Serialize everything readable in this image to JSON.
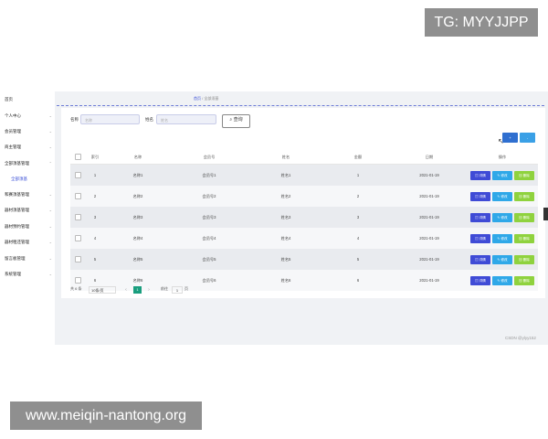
{
  "overlay": {
    "tg": "TG: MYYJJPP",
    "site": "www.meiqin-nantong.org"
  },
  "sidebar": {
    "items": [
      {
        "label": "首页"
      },
      {
        "label": "个人中心"
      },
      {
        "label": "会员管理"
      },
      {
        "label": "商主管理"
      },
      {
        "label": "全部须基管理"
      },
      {
        "label": "全部须基"
      },
      {
        "label": "和赛须基管理"
      },
      {
        "label": "器材须基管理"
      },
      {
        "label": "器材预约管理"
      },
      {
        "label": "器材租还管理"
      },
      {
        "label": "留言板管理"
      },
      {
        "label": "系统管理"
      }
    ]
  },
  "breadcrumb": {
    "home": "首页",
    "sep": "/",
    "current": "全部须基"
  },
  "search": {
    "name_label": "名称",
    "name_placeholder": "名称",
    "person_label": "姓名",
    "person_placeholder": "姓名",
    "button_label": "查询"
  },
  "toolbar": {
    "add_label": "+",
    "delete_label": "-"
  },
  "table": {
    "headers": [
      "",
      "索引",
      "名称",
      "会员号",
      "姓名",
      "金额",
      "日期",
      "操作"
    ],
    "rows": [
      {
        "index": "1",
        "name": "名称1",
        "member": "会员号1",
        "person": "姓名1",
        "amount": "1",
        "date": "2021-01-19"
      },
      {
        "index": "2",
        "name": "名称2",
        "member": "会员号2",
        "person": "姓名2",
        "amount": "2",
        "date": "2021-01-19"
      },
      {
        "index": "3",
        "name": "名称3",
        "member": "会员号3",
        "person": "姓名3",
        "amount": "3",
        "date": "2021-01-19"
      },
      {
        "index": "4",
        "name": "名称4",
        "member": "会员号4",
        "person": "姓名4",
        "amount": "4",
        "date": "2021-01-19"
      },
      {
        "index": "5",
        "name": "名称5",
        "member": "会员号5",
        "person": "姓名5",
        "amount": "5",
        "date": "2021-01-19"
      },
      {
        "index": "6",
        "name": "名称6",
        "member": "会员号6",
        "person": "姓名6",
        "amount": "6",
        "date": "2021-01-19"
      }
    ],
    "actions": {
      "detail": "详情",
      "edit": "修改",
      "delete": "删除"
    }
  },
  "pagination": {
    "total": "共 6 条",
    "page_size": "10条/页",
    "current_page": "1",
    "goto_label": "前往",
    "goto_value": "1",
    "page_suffix": "页"
  },
  "watermark": "CSDN @ylyy152",
  "colors": {
    "primary": "#3f4bd6",
    "info": "#2fa8e8",
    "success": "#8fd23e",
    "pager_active": "#1a9e7e"
  }
}
